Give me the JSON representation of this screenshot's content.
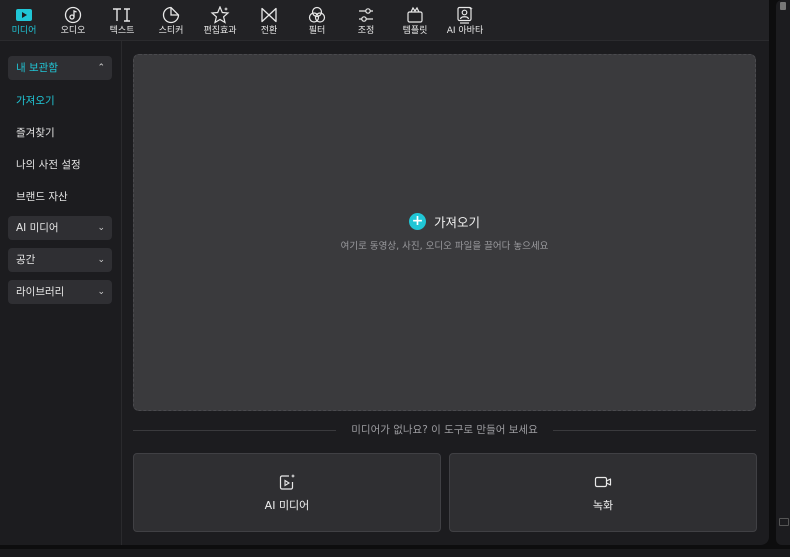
{
  "toolbar": {
    "tools": [
      {
        "label": "미디어",
        "icon": "media-play-icon"
      },
      {
        "label": "오디오",
        "icon": "audio-note-icon"
      },
      {
        "label": "텍스트",
        "icon": "text-ti-icon"
      },
      {
        "label": "스티커",
        "icon": "sticker-icon"
      },
      {
        "label": "편집효과",
        "icon": "effects-star-icon"
      },
      {
        "label": "전환",
        "icon": "transition-bowtie-icon"
      },
      {
        "label": "필터",
        "icon": "filter-icon"
      },
      {
        "label": "조정",
        "icon": "adjust-sliders-icon"
      },
      {
        "label": "템플릿",
        "icon": "template-icon"
      },
      {
        "label": "AI 아바타",
        "icon": "ai-avatar-icon"
      }
    ],
    "active_index": 0
  },
  "sidebar": {
    "library": {
      "label": "내 보관함",
      "expanded": true
    },
    "library_items": [
      "가져오기",
      "즐겨찾기",
      "나의 사전 설정",
      "브랜드 자산"
    ],
    "sections": [
      "AI 미디어",
      "공간",
      "라이브러리"
    ]
  },
  "main": {
    "import_label": "가져오기",
    "drop_hint": "여기로 동영상, 사진, 오디오 파일을 끌어다 놓으세요",
    "divider_text": "미디어가 없나요? 이 도구로 만들어 보세요",
    "cards": [
      {
        "label": "AI 미디어",
        "icon": "ai-media-icon"
      },
      {
        "label": "녹화",
        "icon": "record-camera-icon"
      }
    ]
  },
  "colors": {
    "accent": "#20c6d6",
    "panel": "#1c1c1f",
    "dropzone": "#3a3a3d"
  }
}
